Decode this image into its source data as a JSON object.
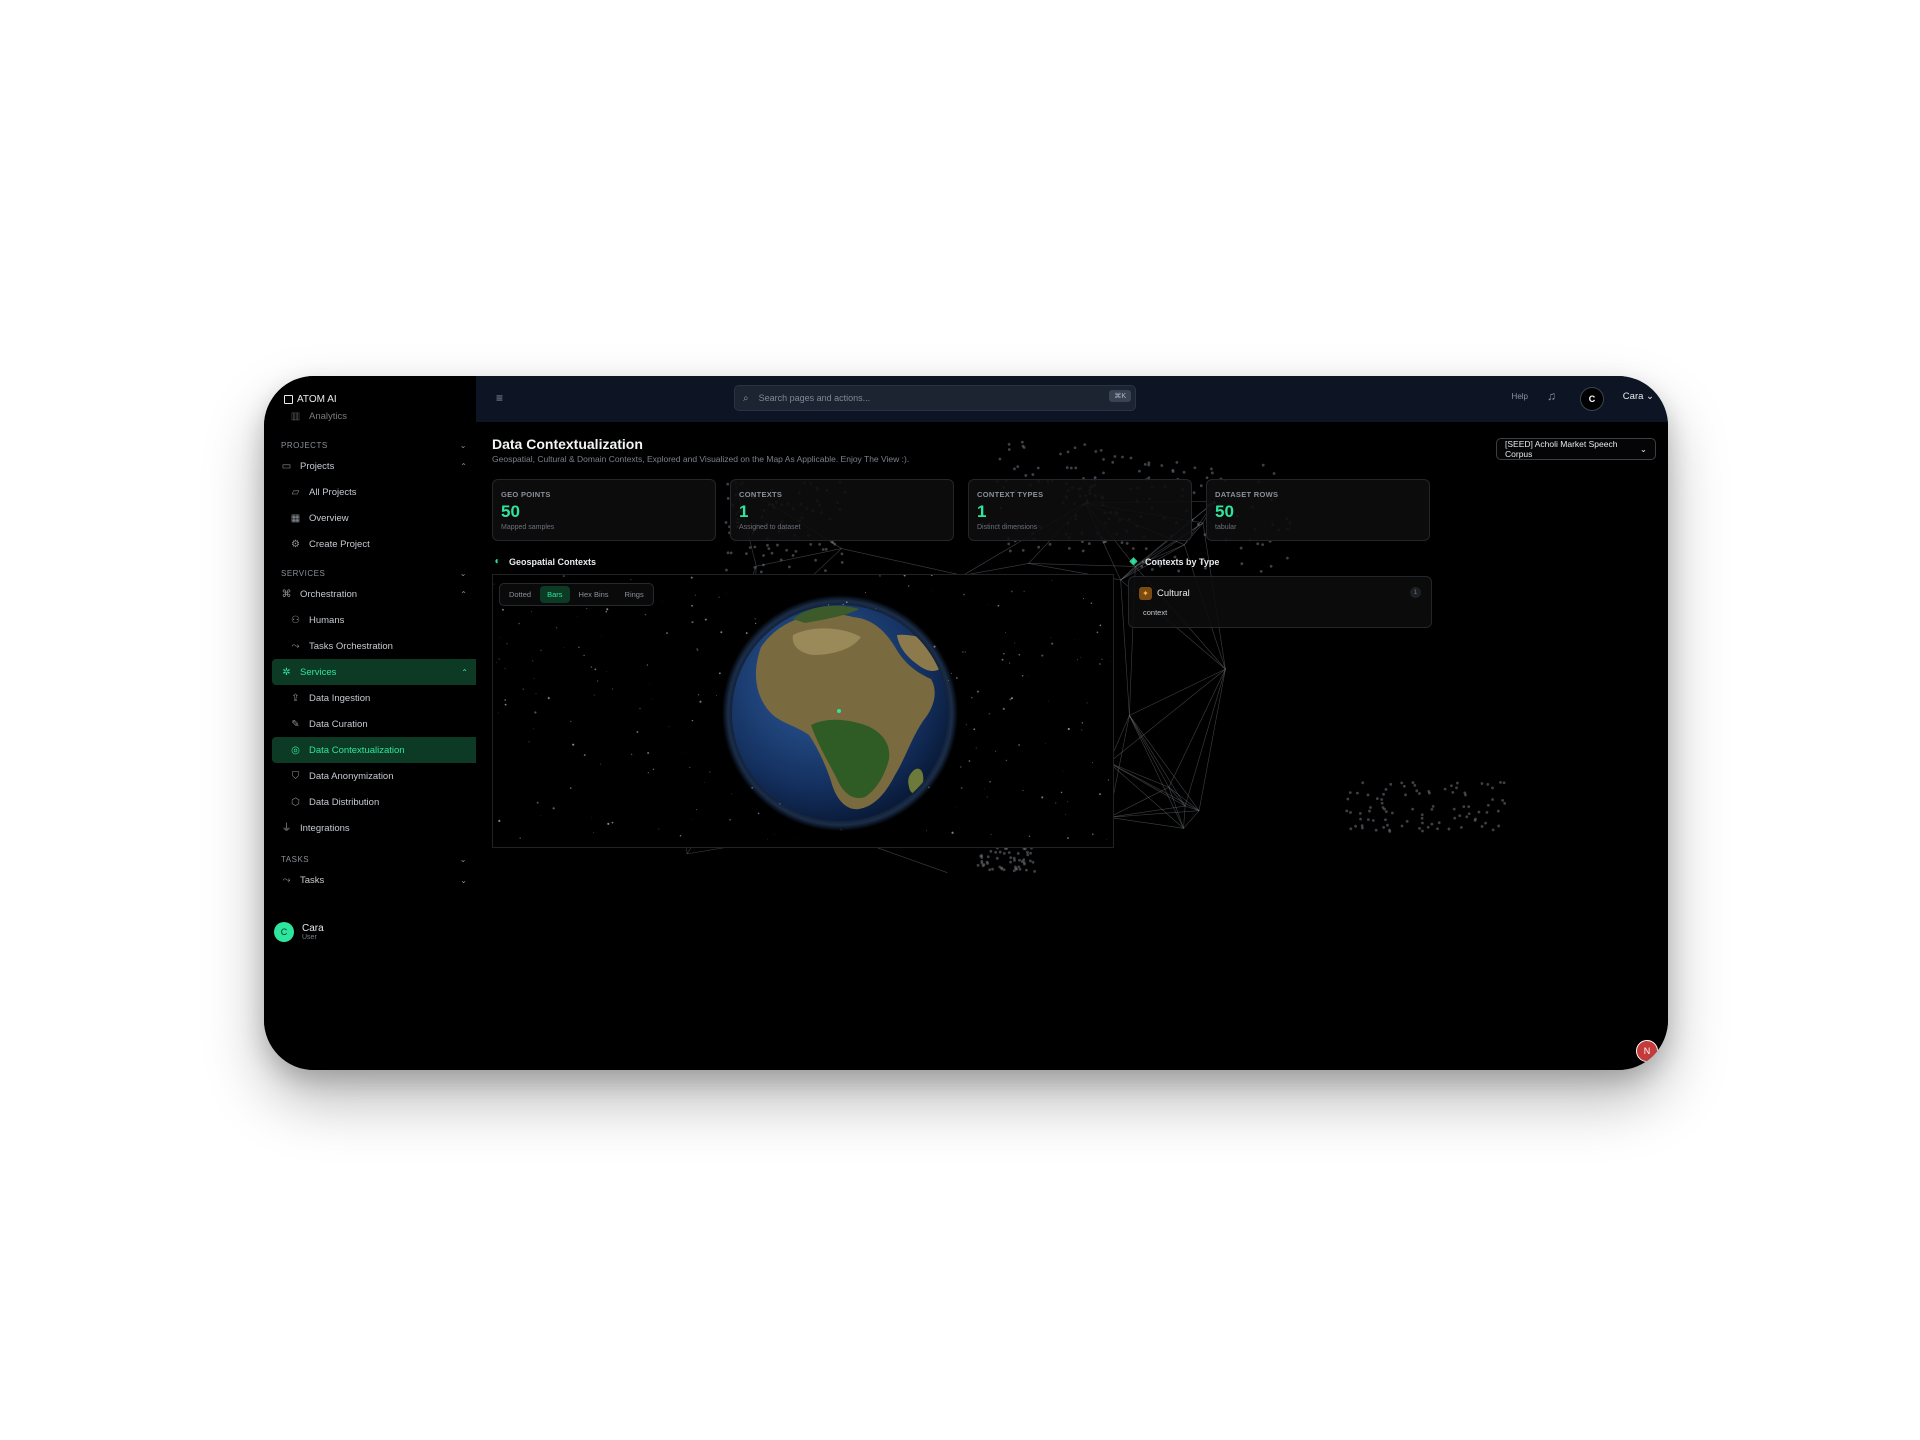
{
  "app": {
    "brand": "ATOM AI"
  },
  "sidebar": {
    "clipped_item": "Analytics",
    "sections": {
      "projects": "PROJECTS",
      "services": "SERVICES",
      "tasks": "TASKS"
    },
    "projects": {
      "group": "Projects",
      "items": [
        "All Projects",
        "Overview",
        "Create Project"
      ]
    },
    "services": {
      "orchestration": "Orchestration",
      "orchestration_items": [
        "Humans",
        "Tasks Orchestration"
      ],
      "services_group": "Services",
      "services_items": [
        "Data Ingestion",
        "Data Curation",
        "Data Contextualization",
        "Data Anonymization",
        "Data Distribution"
      ],
      "integrations": "Integrations"
    },
    "tasks": {
      "group": "Tasks"
    },
    "user": {
      "name": "Cara",
      "role": "User",
      "initial": "C"
    }
  },
  "topbar": {
    "search_placeholder": "Search pages and actions...",
    "shortcut": "⌘K",
    "help": "Help",
    "avatar_initial": "C",
    "user_name": "Cara"
  },
  "main": {
    "title": "Data Contextualization",
    "subtitle": "Geospatial, Cultural & Domain Contexts, Explored and Visualized on the Map As Applicable. Enjoy The View :).",
    "dataset_select": "[SEED] Acholi Market Speech Corpus",
    "stats": [
      {
        "label": "GEO POINTS",
        "value": "50",
        "sub": "Mapped samples"
      },
      {
        "label": "CONTEXTS",
        "value": "1",
        "sub": "Assigned to dataset"
      },
      {
        "label": "CONTEXT TYPES",
        "value": "1",
        "sub": "Distinct dimensions"
      },
      {
        "label": "DATASET ROWS",
        "value": "50",
        "sub": "tabular"
      }
    ],
    "geo_heading": "Geospatial Contexts",
    "viz_tabs": [
      "Dotted",
      "Bars",
      "Hex Bins",
      "Rings"
    ],
    "active_tab": "Bars",
    "contexts_heading": "Contexts by Type",
    "contexts": [
      {
        "name": "Cultural",
        "type": "context",
        "count": "1"
      }
    ]
  },
  "fab": {
    "label": "N"
  },
  "colors": {
    "accent": "#2ee59d",
    "topbar": "#0d1524",
    "active_bg": "#0c3a24"
  }
}
